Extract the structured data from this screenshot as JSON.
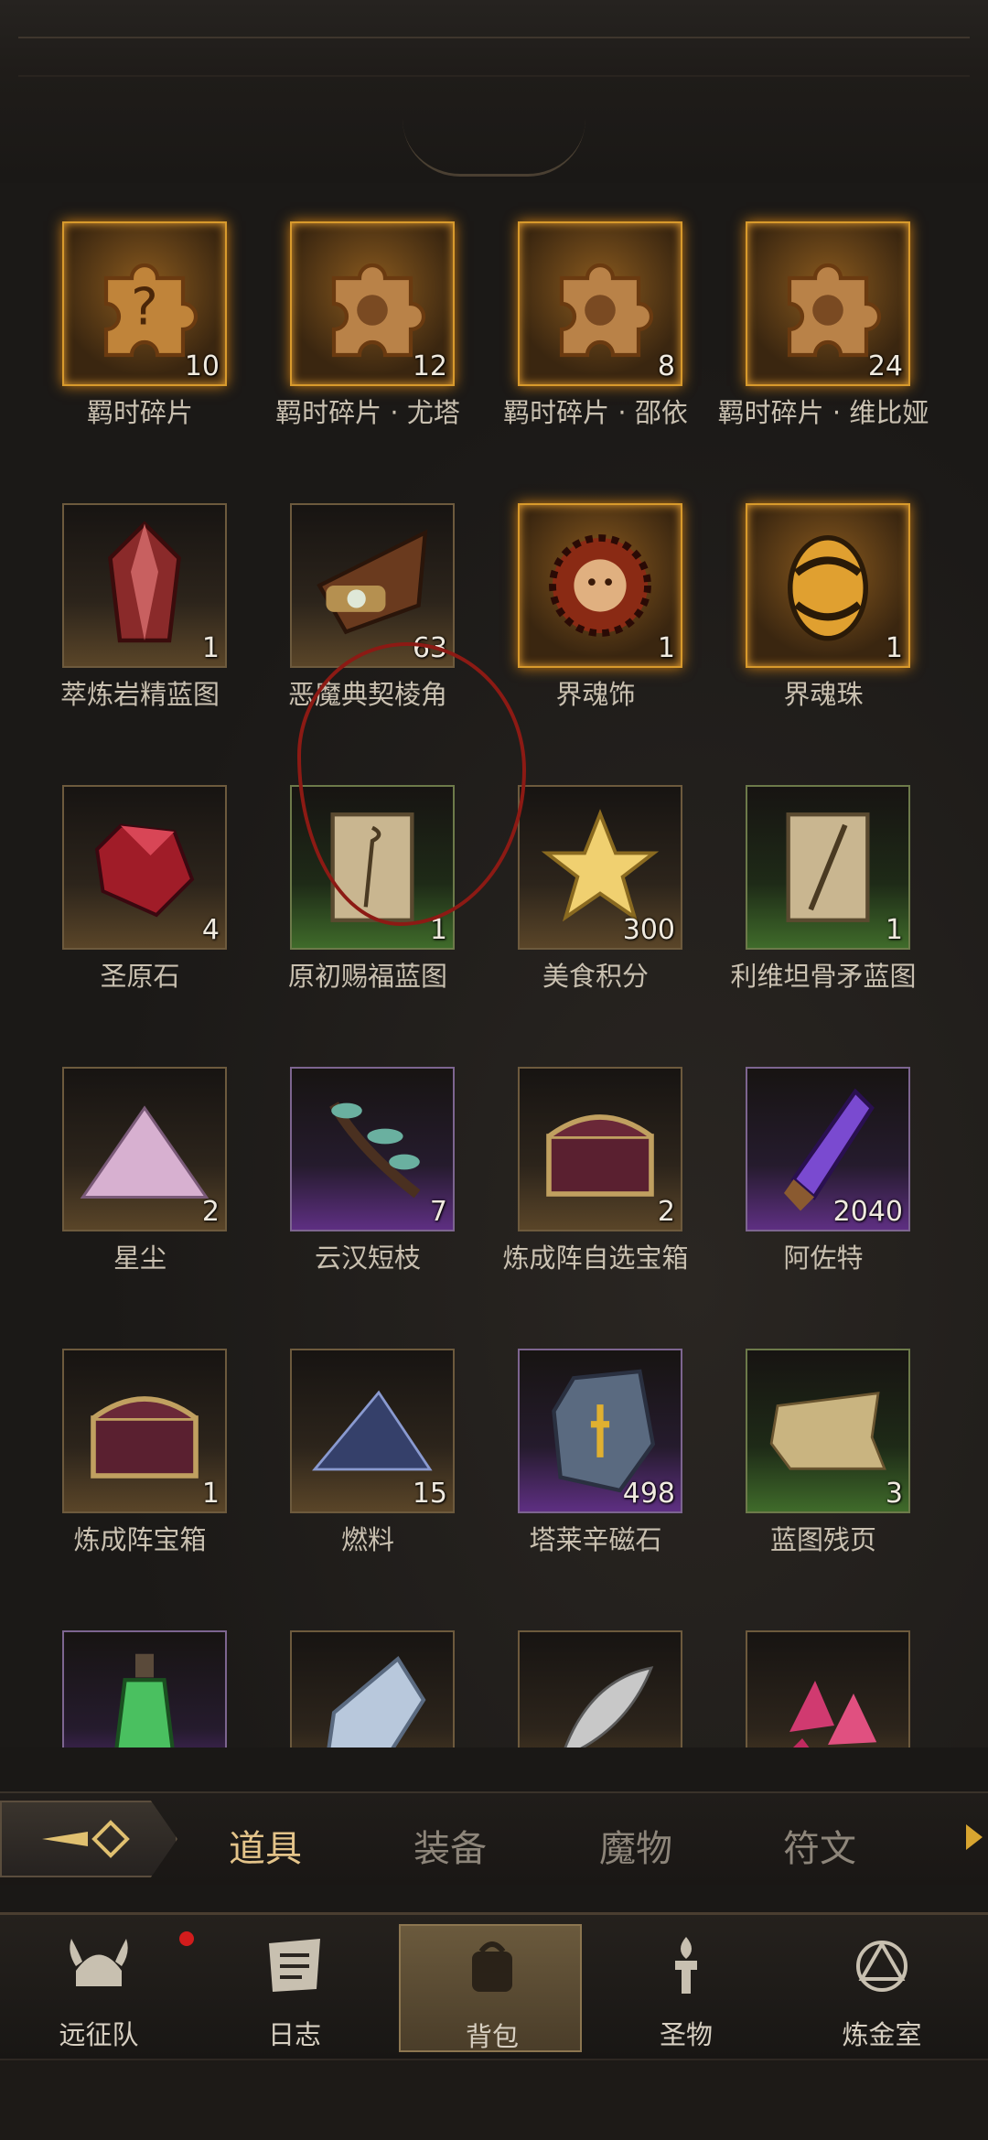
{
  "items": [
    {
      "label": "羁时碎片",
      "count": "10",
      "quality": "gold",
      "icon": "puzzle-piece-question-icon"
    },
    {
      "label": "羁时碎片 · 尤塔",
      "count": "12",
      "quality": "gold",
      "icon": "puzzle-piece-icon"
    },
    {
      "label": "羁时碎片 · 邵依",
      "count": "8",
      "quality": "gold",
      "icon": "puzzle-piece-icon"
    },
    {
      "label": "羁时碎片 · 维比娅",
      "count": "24",
      "quality": "gold",
      "icon": "puzzle-piece-icon"
    },
    {
      "label": "萃炼岩精蓝图",
      "count": "1",
      "quality": "brown",
      "icon": "red-crystal-icon"
    },
    {
      "label": "恶魔典契棱角",
      "count": "63",
      "quality": "brown",
      "icon": "tome-corner-icon"
    },
    {
      "label": "界魂饰",
      "count": "1",
      "quality": "gold",
      "icon": "sun-mask-icon"
    },
    {
      "label": "界魂珠",
      "count": "1",
      "quality": "gold",
      "icon": "orb-egg-icon"
    },
    {
      "label": "圣原石",
      "count": "4",
      "quality": "brown",
      "icon": "ruby-stone-icon"
    },
    {
      "label": "原初赐福蓝图",
      "count": "1",
      "quality": "green",
      "icon": "scroll-staff-icon"
    },
    {
      "label": "美食积分",
      "count": "300",
      "quality": "brown",
      "icon": "gold-star-icon"
    },
    {
      "label": "利维坦骨矛蓝图",
      "count": "1",
      "quality": "green",
      "icon": "scroll-spear-icon"
    },
    {
      "label": "星尘",
      "count": "2",
      "quality": "brown",
      "icon": "stardust-icon"
    },
    {
      "label": "云汉短枝",
      "count": "7",
      "quality": "purple",
      "icon": "branch-icon"
    },
    {
      "label": "炼成阵自选宝箱",
      "count": "2",
      "quality": "brown",
      "icon": "chest-icon"
    },
    {
      "label": "阿佐特",
      "count": "2040",
      "quality": "purple",
      "icon": "vial-purple-icon"
    },
    {
      "label": "炼成阵宝箱",
      "count": "1",
      "quality": "brown",
      "icon": "chest-icon"
    },
    {
      "label": "燃料",
      "count": "15",
      "quality": "brown",
      "icon": "fuel-pyramid-icon"
    },
    {
      "label": "塔莱辛磁石",
      "count": "498",
      "quality": "purple",
      "icon": "rune-stone-icon"
    },
    {
      "label": "蓝图残页",
      "count": "3",
      "quality": "green",
      "icon": "torn-page-icon"
    },
    {
      "label": "",
      "count": "",
      "quality": "purple",
      "icon": "green-potion-icon"
    },
    {
      "label": "",
      "count": "",
      "quality": "brown",
      "icon": "crystal-shard-icon"
    },
    {
      "label": "",
      "count": "",
      "quality": "brown",
      "icon": "feather-icon"
    },
    {
      "label": "",
      "count": "",
      "quality": "brown",
      "icon": "pink-crystal-icon"
    }
  ],
  "tabs": {
    "items": "道具",
    "equipment": "装备",
    "monsters": "魔物",
    "runes": "符文"
  },
  "nav": {
    "expedition": "远征队",
    "journal": "日志",
    "backpack": "背包",
    "relics": "圣物",
    "alchemy": "炼金室"
  },
  "colors": {
    "gold_frame": "#d89a2c",
    "purple": "#5e2f82",
    "green": "#3f6b2a",
    "annotation": "#8c1a14",
    "tab_active": "#e4c48a"
  }
}
